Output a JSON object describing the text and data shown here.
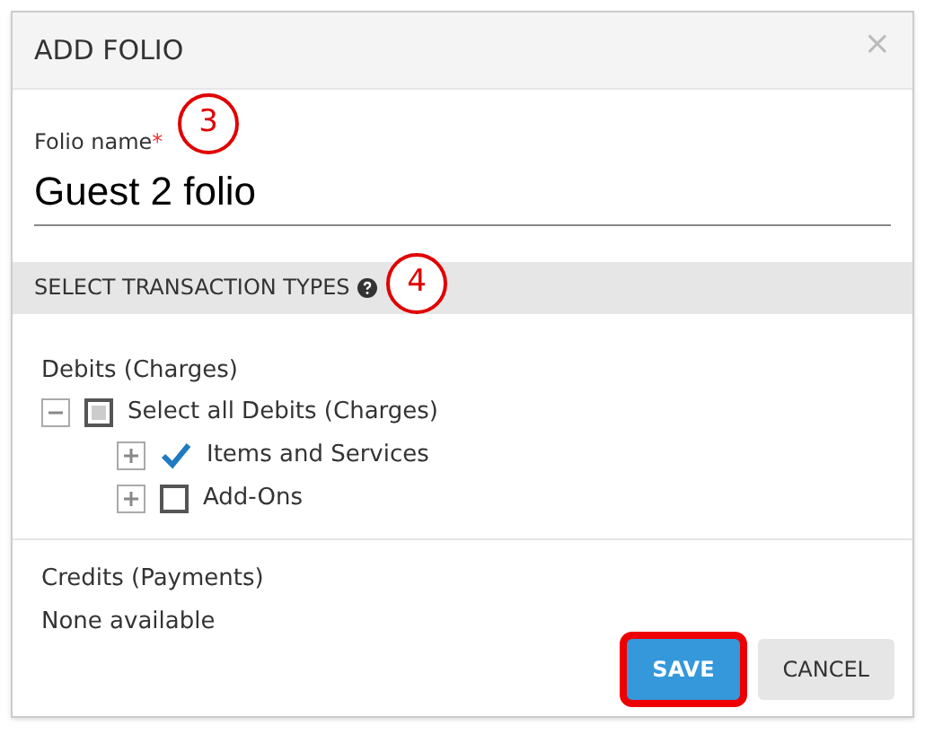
{
  "dialog": {
    "title": "ADD FOLIO",
    "close": "×"
  },
  "field": {
    "label": "Folio name",
    "required_mark": "*",
    "value": "Guest 2 folio"
  },
  "section": {
    "title": "SELECT TRANSACTION TYPES"
  },
  "debits": {
    "heading": "Debits (Charges)",
    "tree": [
      {
        "label": "Select all Debits (Charges)",
        "expanded": true,
        "checked": false,
        "partial": true,
        "children": [
          {
            "label": "Items and Services",
            "expanded": false,
            "checked": true,
            "partial": false
          },
          {
            "label": "Add-Ons",
            "expanded": false,
            "checked": false,
            "partial": false
          }
        ]
      }
    ]
  },
  "credits": {
    "heading": "Credits (Payments)",
    "text": "None available"
  },
  "callouts": [
    {
      "label": "3"
    },
    {
      "label": "4"
    }
  ],
  "buttons": [
    {
      "kind": "primary",
      "label": "SAVE",
      "highlighted": true
    },
    {
      "kind": "secondary",
      "label": "CANCEL",
      "highlighted": false
    }
  ]
}
